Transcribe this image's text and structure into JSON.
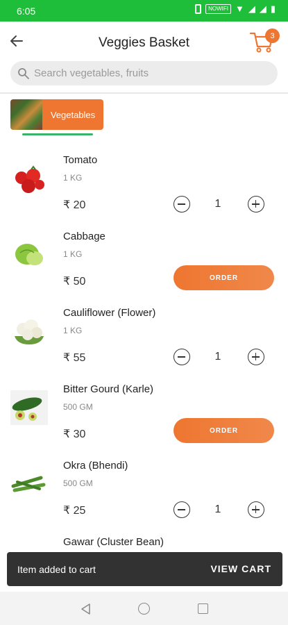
{
  "status_bar": {
    "time": "6:05",
    "network": "NOWIFI"
  },
  "header": {
    "title": "Veggies Basket",
    "cart_count": "3",
    "search_placeholder": "Search vegetables, fruits"
  },
  "category": {
    "label": "Vegetables"
  },
  "products": [
    {
      "name": "Tomato",
      "weight": "1 KG",
      "price": "₹ 20",
      "qty": "1",
      "action": "qty"
    },
    {
      "name": "Cabbage",
      "weight": "1 KG",
      "price": "₹ 50",
      "action": "order",
      "order_label": "ORDER"
    },
    {
      "name": "Cauliflower (Flower)",
      "weight": "1 KG",
      "price": "₹ 55",
      "qty": "1",
      "action": "qty"
    },
    {
      "name": "Bitter Gourd (Karle)",
      "weight": "500 GM",
      "price": "₹ 30",
      "action": "order",
      "order_label": "ORDER"
    },
    {
      "name": "Okra (Bhendi)",
      "weight": "500 GM",
      "price": "₹ 25",
      "qty": "1",
      "action": "qty"
    },
    {
      "name": "Gawar (Cluster Bean)"
    }
  ],
  "snackbar": {
    "message": "Item added to cart",
    "action": "VIEW CART"
  },
  "colors": {
    "accent": "#ee7630",
    "status_bar": "#1fbe3a",
    "tab_indicator": "#39b36a"
  },
  "icons": [
    "back-arrow-icon",
    "cart-icon",
    "search-icon",
    "nav-back-icon",
    "nav-home-icon",
    "nav-recents-icon"
  ]
}
